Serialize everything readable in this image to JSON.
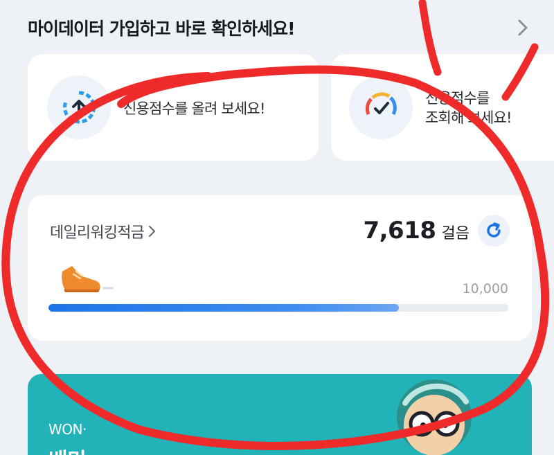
{
  "header": {
    "title": "마이데이터 가입하고 바로 확인하세요!"
  },
  "credit_cards": [
    {
      "label": "신용점수를 올려 보세요!",
      "icon": "arrow-up-gauge-icon"
    },
    {
      "label": "신용점수를\n조회해 보세요!",
      "icon": "check-gauge-icon"
    }
  ],
  "walking": {
    "title": "데일리워킹적금",
    "steps": "7,618",
    "unit": "걸음",
    "goal": "10,000",
    "progress_fraction": 0.7618,
    "icon": "shoe-icon"
  },
  "promo": {
    "line1": "WON·",
    "line2": "배민"
  },
  "colors": {
    "accent": "#1c73e8",
    "promo_bg": "#22b3b8",
    "markup_red": "#ee2a2a"
  }
}
